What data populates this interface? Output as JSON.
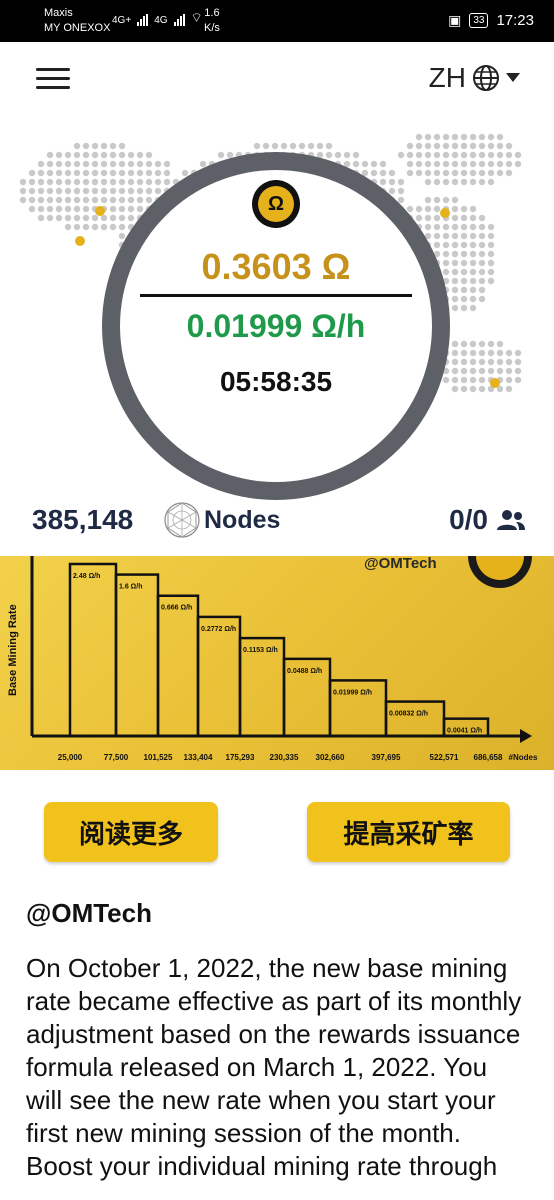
{
  "status_bar": {
    "carrier_line1": "Maxis",
    "carrier_line2": "MY ONEXOX",
    "net1": "4G+",
    "net2": "4G",
    "speed_value": "1.6",
    "speed_unit": "K/s",
    "battery": "33",
    "time": "17:23"
  },
  "header": {
    "language": "ZH",
    "icons": [
      "menu-icon",
      "globe-icon",
      "caret-down-icon"
    ]
  },
  "miner": {
    "balance": "0.3603 Ω",
    "rate": "0.01999 Ω/h",
    "timer": "05:58:35",
    "logo_icon": "omega-logo-icon",
    "colors": {
      "balance": "#c7921a",
      "rate": "#1f9a4b"
    }
  },
  "stats": {
    "nodes_count": "385,148",
    "nodes_label": "Nodes",
    "team": "0/0",
    "team_icon": "users-icon"
  },
  "chart_data": {
    "type": "bar",
    "ylabel": "Base Mining Rate",
    "xlabel": "#Nodes",
    "watermark": "@OMTech",
    "x_ticks": [
      "25,000",
      "77,500",
      "101,525",
      "133,404",
      "175,293",
      "230,335",
      "302,660",
      "397,695",
      "522,571",
      "686,658"
    ],
    "categories": [
      "25,000–77,500",
      "77,500–101,525",
      "101,525–133,404",
      "133,404–175,293",
      "175,293–230,335",
      "230,335–302,660",
      "302,660–397,695",
      "397,695–522,571",
      "522,571–686,658"
    ],
    "values": [
      2.48,
      1.6,
      0.666,
      0.2772,
      0.1153,
      0.0488,
      0.01999,
      0.00832,
      0.0041
    ],
    "value_labels": [
      "2.48 Ω/h",
      "1.6 Ω/h",
      "0.666 Ω/h",
      "0.2772 Ω/h",
      "0.1153 Ω/h",
      "0.0488 Ω/h",
      "0.01999 Ω/h",
      "0.00832 Ω/h",
      "0.0041 Ω/h"
    ]
  },
  "actions": {
    "read_more": "阅读更多",
    "boost": "提高采矿率"
  },
  "article": {
    "title": "@OMTech",
    "body": "On October 1, 2022, the new base mining rate became effective as part of its monthly adjustment based on the rewards issuance formula released on March 1, 2022. You will see the new rate when you start your first new mining session of the month. Boost your individual mining rate through"
  }
}
